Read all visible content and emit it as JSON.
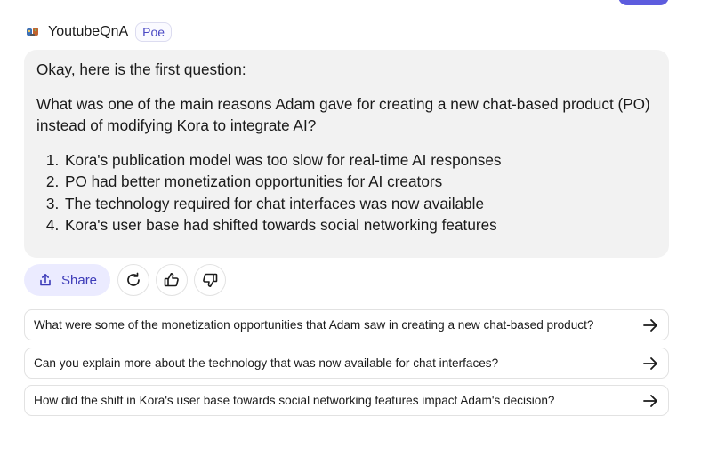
{
  "bot": {
    "name": "YoutubeQnA",
    "badge": "Poe"
  },
  "message": {
    "intro": "Okay, here is the first question:",
    "question": "What was one of the main reasons Adam gave for creating a new chat-based product (PO) instead of modifying Kora to integrate AI?",
    "options": [
      "Kora's publication model was too slow for real-time AI responses",
      "PO had better monetization opportunities for AI creators",
      "The technology required for chat interfaces was now available",
      "Kora's user base had shifted towards social networking features"
    ]
  },
  "actions": {
    "share_label": "Share",
    "icons": [
      "share-icon",
      "retry-icon",
      "thumbs-up-icon",
      "thumbs-down-icon"
    ]
  },
  "suggestions": [
    "What were some of the monetization opportunities that Adam saw in creating a new chat-based product?",
    "Can you explain more about the technology that was now available for chat interfaces?",
    "How did the shift in Kora's user base towards social networking features impact Adam's decision?"
  ],
  "colors": {
    "accent": "#5d5cde",
    "share_bg": "#ebebff",
    "share_text": "#3b3ab8",
    "bubble_bg": "#f2f2f2"
  }
}
